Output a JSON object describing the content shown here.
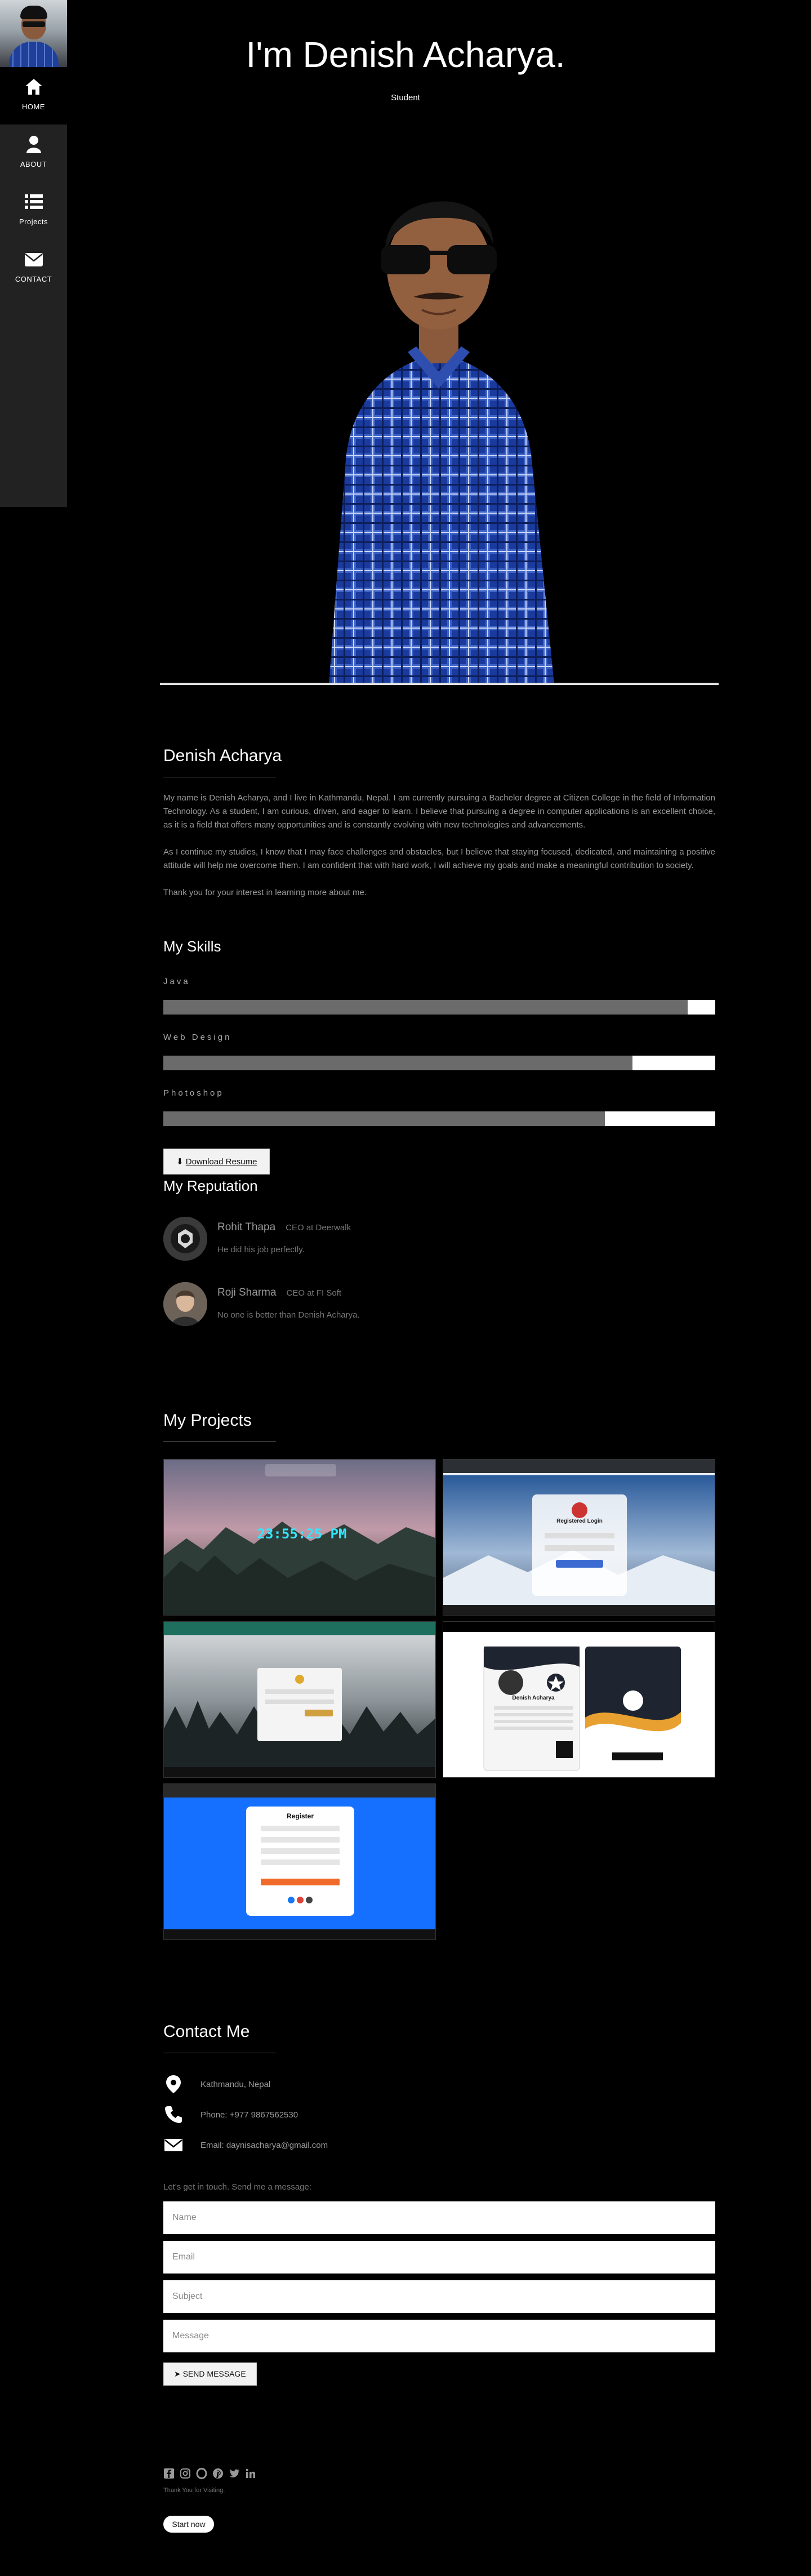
{
  "sidebar": {
    "items": [
      {
        "label": "HOME",
        "icon": "home-icon"
      },
      {
        "label": "ABOUT",
        "icon": "user-icon"
      },
      {
        "label": "Projects",
        "icon": "list-icon"
      },
      {
        "label": "CONTACT",
        "icon": "envelope-icon"
      }
    ]
  },
  "hero": {
    "title": "I'm Denish Acharya.",
    "subtitle": "Student"
  },
  "about": {
    "name": "Denish Acharya",
    "paragraphs": [
      "My name is Denish Acharya, and I live in Kathmandu, Nepal. I am currently pursuing a Bachelor degree at Citizen College in the field of Information Technology. As a student, I am curious, driven, and eager to learn. I believe that pursuing a degree in computer applications is an excellent choice, as it is a field that offers many opportunities and is constantly evolving with new technologies and advancements.",
      "As I continue my studies, I know that I may face challenges and obstacles, but I believe that staying focused, dedicated, and maintaining a positive attitude will help me overcome them. I am confident that with hard work, I will achieve my goals and make a meaningful contribution to society.",
      "Thank you for your interest in learning more about me."
    ]
  },
  "skills": {
    "title": "My Skills",
    "items": [
      {
        "label": "Java",
        "level": 0.95
      },
      {
        "label": "Web Design",
        "level": 0.85
      },
      {
        "label": "Photoshop",
        "level": 0.8
      }
    ],
    "download_label": "Download Resume"
  },
  "reputation": {
    "title": "My Reputation",
    "items": [
      {
        "name": "Rohit Thapa",
        "role": "CEO at Deerwalk",
        "quote": "He did his job perfectly."
      },
      {
        "name": "Roji Sharma",
        "role": "CEO at FI Soft",
        "quote": "No one is better than Denish Acharya."
      }
    ]
  },
  "projects": {
    "title": "My Projects",
    "items": [
      {
        "name": "weather-clock-project",
        "caption": "23:55:25 PM"
      },
      {
        "name": "registration-login-project",
        "caption": "Registered Login"
      },
      {
        "name": "forest-login-project",
        "caption": ""
      },
      {
        "name": "id-card-project",
        "caption": "Denish Acharya"
      },
      {
        "name": "register-form-project",
        "caption": "Register"
      }
    ]
  },
  "contact": {
    "title": "Contact Me",
    "address": "Kathmandu, Nepal",
    "phone": "Phone: +977 9867562530",
    "email": "Email: daynisacharya@gmail.com",
    "intro": "Let's get in touch. Send me a message:",
    "placeholders": {
      "name": "Name",
      "email": "Email",
      "subject": "Subject",
      "message": "Message"
    },
    "send_label": "SEND MESSAGE"
  },
  "footer": {
    "icons": [
      "facebook-icon",
      "instagram-icon",
      "opera-icon",
      "pinterest-icon",
      "twitter-icon",
      "linkedin-icon"
    ],
    "thanks": "Thank You for Visiting.",
    "start_label": "Start now"
  },
  "colors": {
    "background": "#000000",
    "sidebar": "#222222",
    "skill_fill": "#6b6b6b",
    "muted_text": "#9a9a9a"
  }
}
